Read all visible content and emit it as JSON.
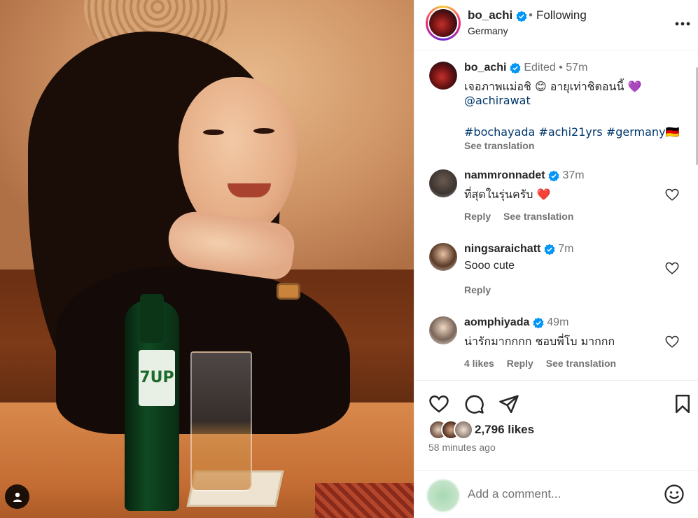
{
  "post": {
    "username": "bo_achi",
    "follow_state": "Following",
    "separator": "•",
    "location": "Germany",
    "more_icon": "more-horizontal-icon"
  },
  "caption": {
    "username": "bo_achi",
    "edited": "Edited",
    "dot": "•",
    "time": "57m",
    "line1": "เจอภาพแม่อชิ 😊 อายุเท่าชิตอนนี้ 💜",
    "mention": "@achirawat",
    "hashtags": "#bochayada #achi21yrs #germany🇩🇪",
    "see_translation": "See translation"
  },
  "comments": [
    {
      "username": "nammronnadet",
      "verified": true,
      "time": "37m",
      "text": "ที่สุดในรุ่นครับ ❤️",
      "actions": [
        "Reply",
        "See translation"
      ]
    },
    {
      "username": "ningsaraichatt",
      "verified": true,
      "time": "7m",
      "text": "Sooo cute",
      "actions": [
        "Reply"
      ]
    },
    {
      "username": "aomphiyada",
      "verified": true,
      "time": "49m",
      "text": "น่ารักมากกกก ชอบพี่โบ มากกก",
      "actions": [
        "4 likes",
        "Reply",
        "See translation"
      ]
    }
  ],
  "actions": {
    "like_icon": "heart-icon",
    "comment_icon": "comment-icon",
    "share_icon": "share-icon",
    "save_icon": "bookmark-icon"
  },
  "likes": {
    "count": "2,796 likes",
    "time_ago": "58 minutes ago"
  },
  "add_comment": {
    "placeholder": "Add a comment...",
    "emoji_icon": "emoji-icon"
  },
  "photo": {
    "bottle_label": "7UP",
    "tag_icon": "user-tag-icon"
  },
  "colors": {
    "verified": "#0095f6",
    "link": "#00376b",
    "muted": "#737373",
    "text": "#262626",
    "purple_heart": "#8e44ad",
    "red_heart": "#e0245e"
  }
}
